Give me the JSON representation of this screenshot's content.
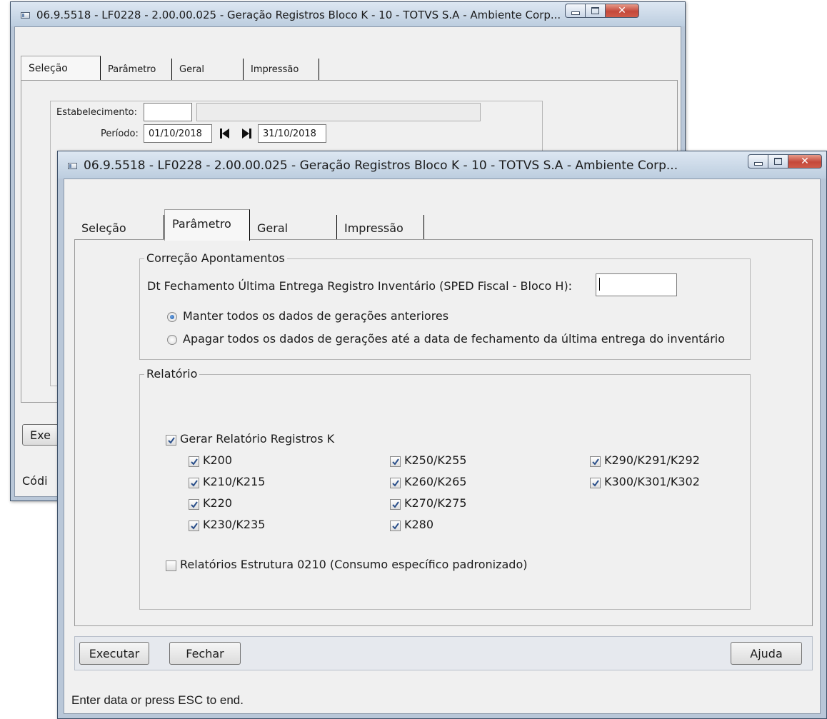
{
  "back_window": {
    "title": "06.9.5518 - LF0228 - 2.00.00.025 - Geração Registros Bloco K - 10 - TOTVS S.A - Ambiente Corp...",
    "tabs": [
      "Seleção",
      "Parâmetro",
      "Geral",
      "Impressão"
    ],
    "estabelecimento_label": "Estabelecimento:",
    "estabelecimento_value": "",
    "periodo_label": "Período:",
    "periodo_inicio": "01/10/2018",
    "periodo_fim": "31/10/2018",
    "execute_partial": "Exe",
    "status_partial": "Códi"
  },
  "window": {
    "title": "06.9.5518 - LF0228 - 2.00.00.025 - Geração Registros Bloco K - 10 - TOTVS S.A - Ambiente Corp...",
    "tabs": [
      "Seleção",
      "Parâmetro",
      "Geral",
      "Impressão"
    ],
    "active_tab": "Parâmetro",
    "correcao": {
      "legend": "Correção Apontamentos",
      "dt_label": "Dt Fechamento Última Entrega Registro Inventário (SPED Fiscal - Bloco H):",
      "dt_value": "",
      "radio_manter": "Manter todos os dados de gerações anteriores",
      "radio_apagar": "Apagar todos os dados de gerações até a data de fechamento da última entrega do inventário",
      "selected": "manter"
    },
    "relatorio": {
      "legend": "Relatório",
      "gerar_label": "Gerar Relatório Registros K",
      "gerar_checked": true,
      "col1": [
        "K200",
        "K210/K215",
        "K220",
        "K230/K235"
      ],
      "col2": [
        "K250/K255",
        "K260/K265",
        "K270/K275",
        "K280"
      ],
      "col3": [
        "K290/K291/K292",
        "K300/K301/K302"
      ],
      "estrutura_label": "Relatórios Estrutura 0210 (Consumo específico padronizado)",
      "estrutura_checked": false
    },
    "buttons": {
      "executar": "Executar",
      "fechar": "Fechar",
      "ajuda": "Ajuda"
    },
    "status_text": "Enter data or press ESC to end."
  }
}
